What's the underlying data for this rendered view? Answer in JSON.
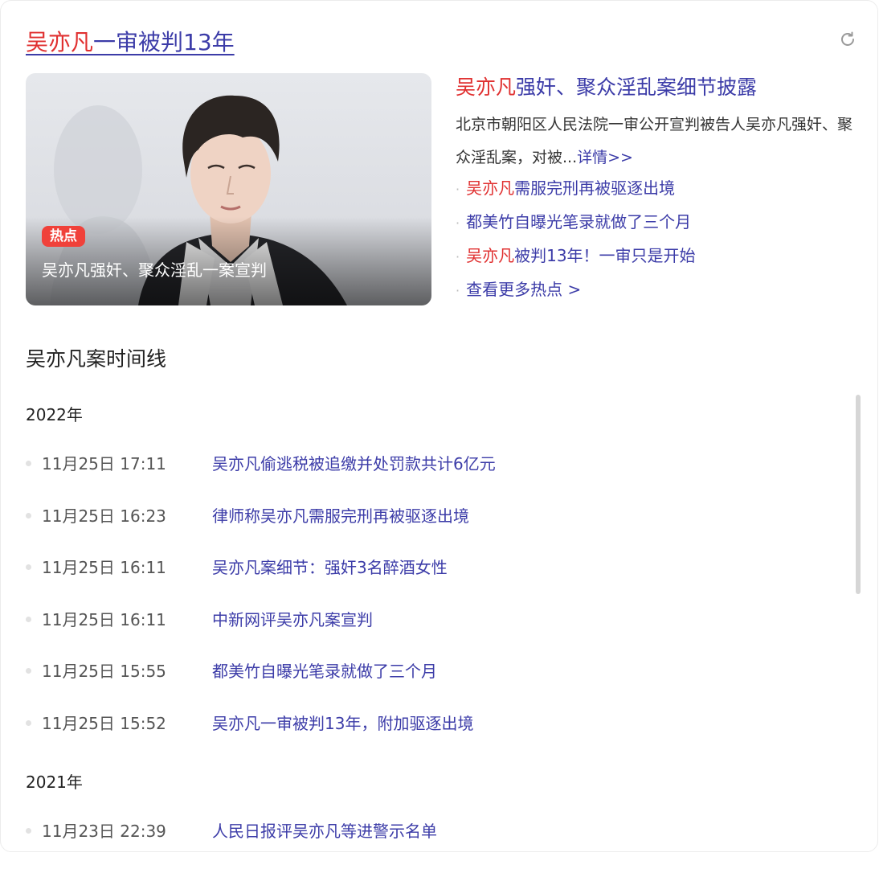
{
  "card": {
    "title_highlight": "吴亦凡",
    "title_rest": "一审被判13年",
    "refresh_icon": "refresh-icon"
  },
  "hero": {
    "badge": "热点",
    "caption": "吴亦凡强奸、聚众淫乱一案宣判"
  },
  "story": {
    "headline_highlight": "吴亦凡",
    "headline_rest": "强奸、聚众淫乱案细节披露",
    "summary": "北京市朝阳区人民法院一审公开宣判被告人吴亦凡强奸、聚众淫乱案，对被...",
    "more_link": "详情>>"
  },
  "related": [
    {
      "highlight": "吴亦凡",
      "rest": "需服完刑再被驱逐出境"
    },
    {
      "highlight": "",
      "rest": "都美竹自曝光笔录就做了三个月"
    },
    {
      "highlight": "吴亦凡",
      "rest": "被判13年！一审只是开始"
    },
    {
      "highlight": "",
      "rest": "查看更多热点 >"
    }
  ],
  "timeline": {
    "title": "吴亦凡案时间线",
    "groups": [
      {
        "year": "2022年",
        "items": [
          {
            "time": "11月25日 17:11",
            "text": "吴亦凡偷逃税被追缴并处罚款共计6亿元"
          },
          {
            "time": "11月25日 16:23",
            "text": "律师称吴亦凡需服完刑再被驱逐出境"
          },
          {
            "time": "11月25日 16:11",
            "text": "吴亦凡案细节：强奸3名醉酒女性"
          },
          {
            "time": "11月25日 16:11",
            "text": "中新网评吴亦凡案宣判"
          },
          {
            "time": "11月25日 15:55",
            "text": "都美竹自曝光笔录就做了三个月"
          },
          {
            "time": "11月25日 15:52",
            "text": "吴亦凡一审被判13年，附加驱逐出境"
          }
        ]
      },
      {
        "year": "2021年",
        "items": [
          {
            "time": "11月23日 22:39",
            "text": "人民日报评吴亦凡等进警示名单"
          }
        ]
      }
    ]
  },
  "colors": {
    "link": "#3c3ca8",
    "highlight": "#e03030",
    "badge": "#f0413a"
  }
}
